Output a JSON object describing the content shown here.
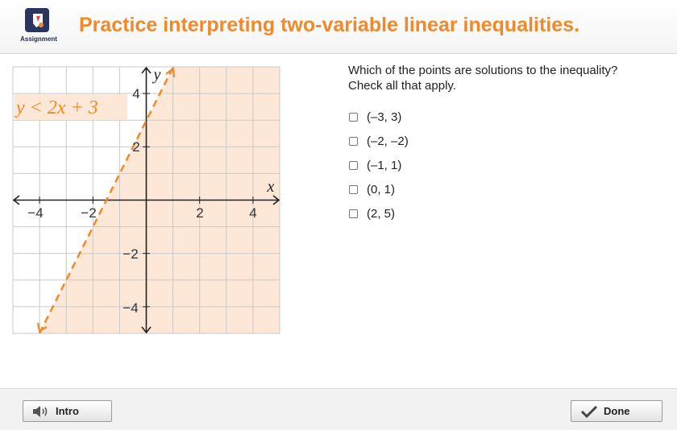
{
  "header": {
    "logo_label": "Assignment",
    "title": "Practice interpreting two-variable linear inequalities."
  },
  "graph": {
    "inequality_label": "y < 2x + 3",
    "x_axis_label": "x",
    "y_axis_label": "y",
    "x_ticks": [
      "−4",
      "−2",
      "2",
      "4"
    ],
    "y_ticks": [
      "4",
      "2",
      "−2",
      "−4"
    ],
    "boundary": {
      "slope": 2,
      "intercept": 3,
      "style": "dashed"
    },
    "shading": "below/right of line",
    "colors": {
      "shade": "#fde8d7",
      "line": "#f0892a",
      "grid": "#c9c9c9"
    }
  },
  "question": {
    "line1": "Which of the points are solutions to the inequality?",
    "line2": "Check all that apply.",
    "options": [
      "(–3, 3)",
      "(–2, –2)",
      "(–1, 1)",
      "(0, 1)",
      "(2, 5)"
    ]
  },
  "footer": {
    "intro_label": "Intro",
    "done_label": "Done"
  },
  "colors": {
    "accent": "#f0892a"
  }
}
